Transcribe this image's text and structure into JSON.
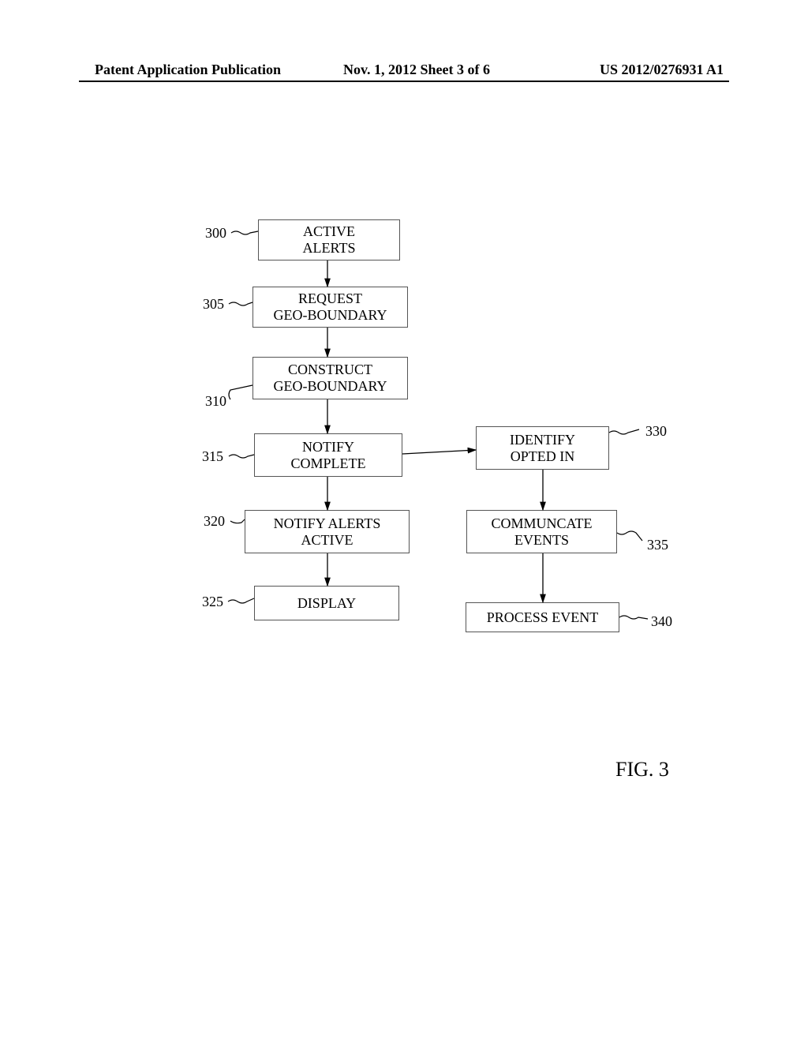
{
  "header": {
    "left": "Patent Application Publication",
    "middle": "Nov. 1, 2012  Sheet 3 of 6",
    "right": "US 2012/0276931 A1"
  },
  "boxes": {
    "b300": "ACTIVE\nALERTS",
    "b305": "REQUEST\nGEO-BOUNDARY",
    "b310": "CONSTRUCT\nGEO-BOUNDARY",
    "b315": "NOTIFY\nCOMPLETE",
    "b320": "NOTIFY ALERTS\nACTIVE",
    "b325": "DISPLAY",
    "b330": "IDENTIFY\nOPTED IN",
    "b335": "COMMUNCATE\nEVENTS",
    "b340": "PROCESS EVENT"
  },
  "labels": {
    "l300": "300",
    "l305": "305",
    "l310": "310",
    "l315": "315",
    "l320": "320",
    "l325": "325",
    "l330": "330",
    "l335": "335",
    "l340": "340"
  },
  "figure": "FIG. 3"
}
